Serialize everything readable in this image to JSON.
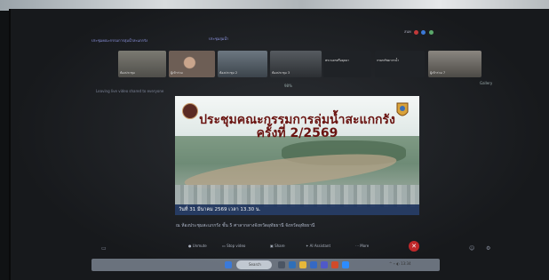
{
  "meeting": {
    "topbar_left": "ประชุมคณะกรรมการลุ่มน้ำสะแกกรัง",
    "topbar_center": "ประชุมลุ่มน้ำ",
    "top_right_label": "สนท",
    "participants": [
      {
        "label": "ห้องประชุม",
        "bg": "#5a5a55"
      },
      {
        "label": "ผู้เข้าร่วม",
        "bg": "#6d5e55"
      },
      {
        "label": "ห้องประชุม 2",
        "bg": "#47515a"
      },
      {
        "label": "ห้องประชุม 3",
        "bg": "#3b3f44"
      },
      {
        "label": "พระนครศรีอยุธยา",
        "bg": "#22252a"
      },
      {
        "label": "กรมทรัพยากรน้ำ",
        "bg": "#22252a"
      },
      {
        "label": "ผู้เข้าร่วม 7",
        "bg": "#5f5e5a"
      }
    ],
    "status_left": "Leaving live video shared to everyone",
    "status_mid": "98%",
    "status_right": "Gallery"
  },
  "slide": {
    "title_line1": "ประชุมคณะกรรมการลุ่มน้ำสะแกกรัง",
    "title_line2": "ครั้งที่ 2/2569",
    "date_line": "วันที่ 31 มีนาคม 2569 เวลา 13.30 น."
  },
  "venue_text": "ณ ห้องประชุมสะแกกรัง ชั้น 5 ศาลากลางจังหวัดอุทัยธานี จังหวัดอุทัยธานี",
  "controls": [
    {
      "label": "Unmute",
      "icon": "mic-icon"
    },
    {
      "label": "Stop video",
      "icon": "camera-icon"
    },
    {
      "label": "Share",
      "icon": "share-icon"
    },
    {
      "label": "AI Assistant",
      "icon": "ai-icon"
    },
    {
      "label": "More",
      "icon": "more-icon"
    }
  ],
  "taskbar": {
    "search_label": "Search",
    "clock": "13:34"
  },
  "colors": {
    "leave_red": "#c0282a",
    "slide_title": "#6a1411",
    "footer_band": "#122856"
  }
}
